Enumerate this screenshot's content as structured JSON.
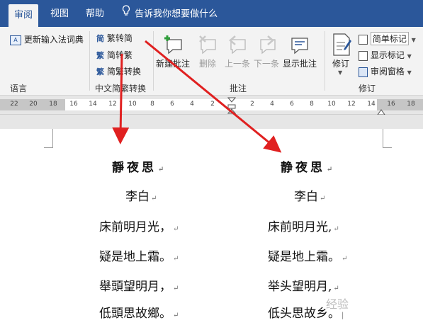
{
  "tabs": {
    "review": "审阅",
    "view": "视图",
    "help": "帮助",
    "tellme": "告诉我你想要做什么"
  },
  "ribbon": {
    "language": {
      "update_ime": "更新输入法词典",
      "group_label": "语言"
    },
    "chinese_conversion": {
      "trad_to_simp": "繁转简",
      "simp_to_trad": "简转繁",
      "convert": "简繁转换",
      "group_label": "中文简繁转换"
    },
    "comments": {
      "new": "新建批注",
      "delete": "删除",
      "prev": "上一条",
      "next": "下一条",
      "show": "显示批注",
      "group_label": "批注"
    },
    "tracking": {
      "track": "修订",
      "markup_mode": "简单标记",
      "show_markup": "显示标记",
      "review_pane": "审阅窗格",
      "group_label": "修订"
    }
  },
  "ruler": {
    "left": [
      "22",
      "20",
      "18"
    ],
    "right": [
      "16",
      "14",
      "12",
      "10",
      "8",
      "6",
      "4",
      "2",
      "2",
      "4",
      "6",
      "8",
      "10",
      "12",
      "14",
      "16",
      "18"
    ]
  },
  "document": {
    "traditional": [
      "靜夜思",
      "李白",
      "床前明月光，",
      "疑是地上霜。",
      "舉頭望明月，",
      "低頭思故鄉。"
    ],
    "simplified": [
      "静夜思",
      "李白",
      "床前明月光,",
      "疑是地上霜。",
      "举头望明月,",
      "低头思故乡。"
    ]
  },
  "arrow_color": "#e02020",
  "watermark": "经验"
}
